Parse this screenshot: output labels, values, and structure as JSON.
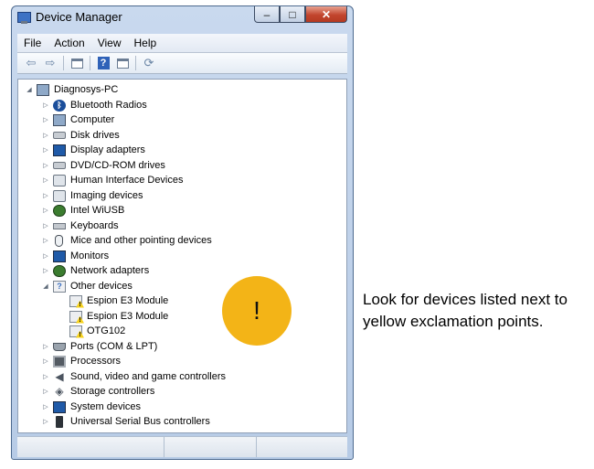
{
  "window": {
    "title": "Device Manager",
    "controls": {
      "minimize": "–",
      "maximize": "□",
      "close": "✕"
    }
  },
  "menubar": {
    "items": [
      "File",
      "Action",
      "View",
      "Help"
    ]
  },
  "toolbar": {
    "buttons": [
      "back-icon",
      "forward-icon",
      "properties-pane-icon",
      "help-icon",
      "console-tree-icon",
      "scan-hardware-icon"
    ]
  },
  "tree": {
    "root": "Diagnosys-PC",
    "items": [
      {
        "label": "Bluetooth Radios",
        "icon": "bluetooth-icon"
      },
      {
        "label": "Computer",
        "icon": "computer-icon"
      },
      {
        "label": "Disk drives",
        "icon": "disk-drive-icon"
      },
      {
        "label": "Display adapters",
        "icon": "display-adapter-icon"
      },
      {
        "label": "DVD/CD-ROM drives",
        "icon": "dvd-drive-icon"
      },
      {
        "label": "Human Interface Devices",
        "icon": "hid-icon"
      },
      {
        "label": "Imaging devices",
        "icon": "imaging-icon"
      },
      {
        "label": "Intel WiUSB",
        "icon": "usb-wireless-icon"
      },
      {
        "label": "Keyboards",
        "icon": "keyboard-icon"
      },
      {
        "label": "Mice and other pointing devices",
        "icon": "mouse-icon"
      },
      {
        "label": "Monitors",
        "icon": "monitor-icon"
      },
      {
        "label": "Network adapters",
        "icon": "network-icon"
      },
      {
        "label": "Other devices",
        "icon": "other-devices-icon"
      },
      {
        "label": "Espion E3 Module",
        "icon": "warning-device-icon"
      },
      {
        "label": "Espion E3 Module",
        "icon": "warning-device-icon"
      },
      {
        "label": "OTG102",
        "icon": "warning-device-icon"
      },
      {
        "label": "Ports (COM & LPT)",
        "icon": "port-icon"
      },
      {
        "label": "Processors",
        "icon": "processor-icon"
      },
      {
        "label": "Sound, video and game controllers",
        "icon": "sound-icon"
      },
      {
        "label": "Storage controllers",
        "icon": "storage-icon"
      },
      {
        "label": "System devices",
        "icon": "system-devices-icon"
      },
      {
        "label": "Universal Serial Bus controllers",
        "icon": "usb-icon"
      }
    ]
  },
  "callout": {
    "symbol": "!",
    "color": "#f3b417",
    "caption": "Look for devices listed next to yellow exclamation points."
  }
}
